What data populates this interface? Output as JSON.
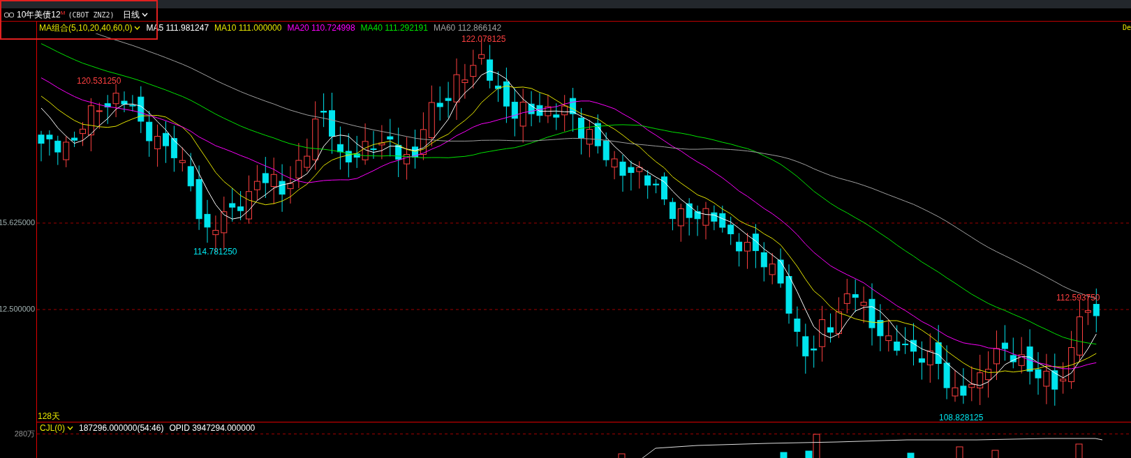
{
  "instrument": {
    "name": "10年美债12",
    "badge": "M",
    "code": "(CBOT ZNZ2)",
    "period": "日线"
  },
  "legend": {
    "group": "MA组合(5,10,20,40,60,0)",
    "items": [
      {
        "label": "MA5",
        "value": "111.981247",
        "color": "#ffffff"
      },
      {
        "label": "MA10",
        "value": "111.000000",
        "color": "#e6e600"
      },
      {
        "label": "MA20",
        "value": "110.724998",
        "color": "#ff00ff"
      },
      {
        "label": "MA40",
        "value": "111.292191",
        "color": "#00e600"
      },
      {
        "label": "MA60",
        "value": "112.866142",
        "color": "#a0a0a0"
      }
    ]
  },
  "corner_text": "De",
  "price_axis": [
    {
      "label": "15.625000"
    },
    {
      "label": "12.500000"
    }
  ],
  "annotations": [
    {
      "text": "120.531250",
      "kind": "high"
    },
    {
      "text": "122.078125",
      "kind": "high"
    },
    {
      "text": "114.781250",
      "kind": "low"
    },
    {
      "text": "108.828125",
      "kind": "low"
    },
    {
      "text": "112.593750",
      "kind": "high"
    }
  ],
  "range_label": "128天",
  "volume_panel": {
    "axis_label": "280万",
    "indicator": "CJL(0)",
    "reading": "187296.000000(54:46)",
    "opid": "OPID 3947294.000000"
  }
}
